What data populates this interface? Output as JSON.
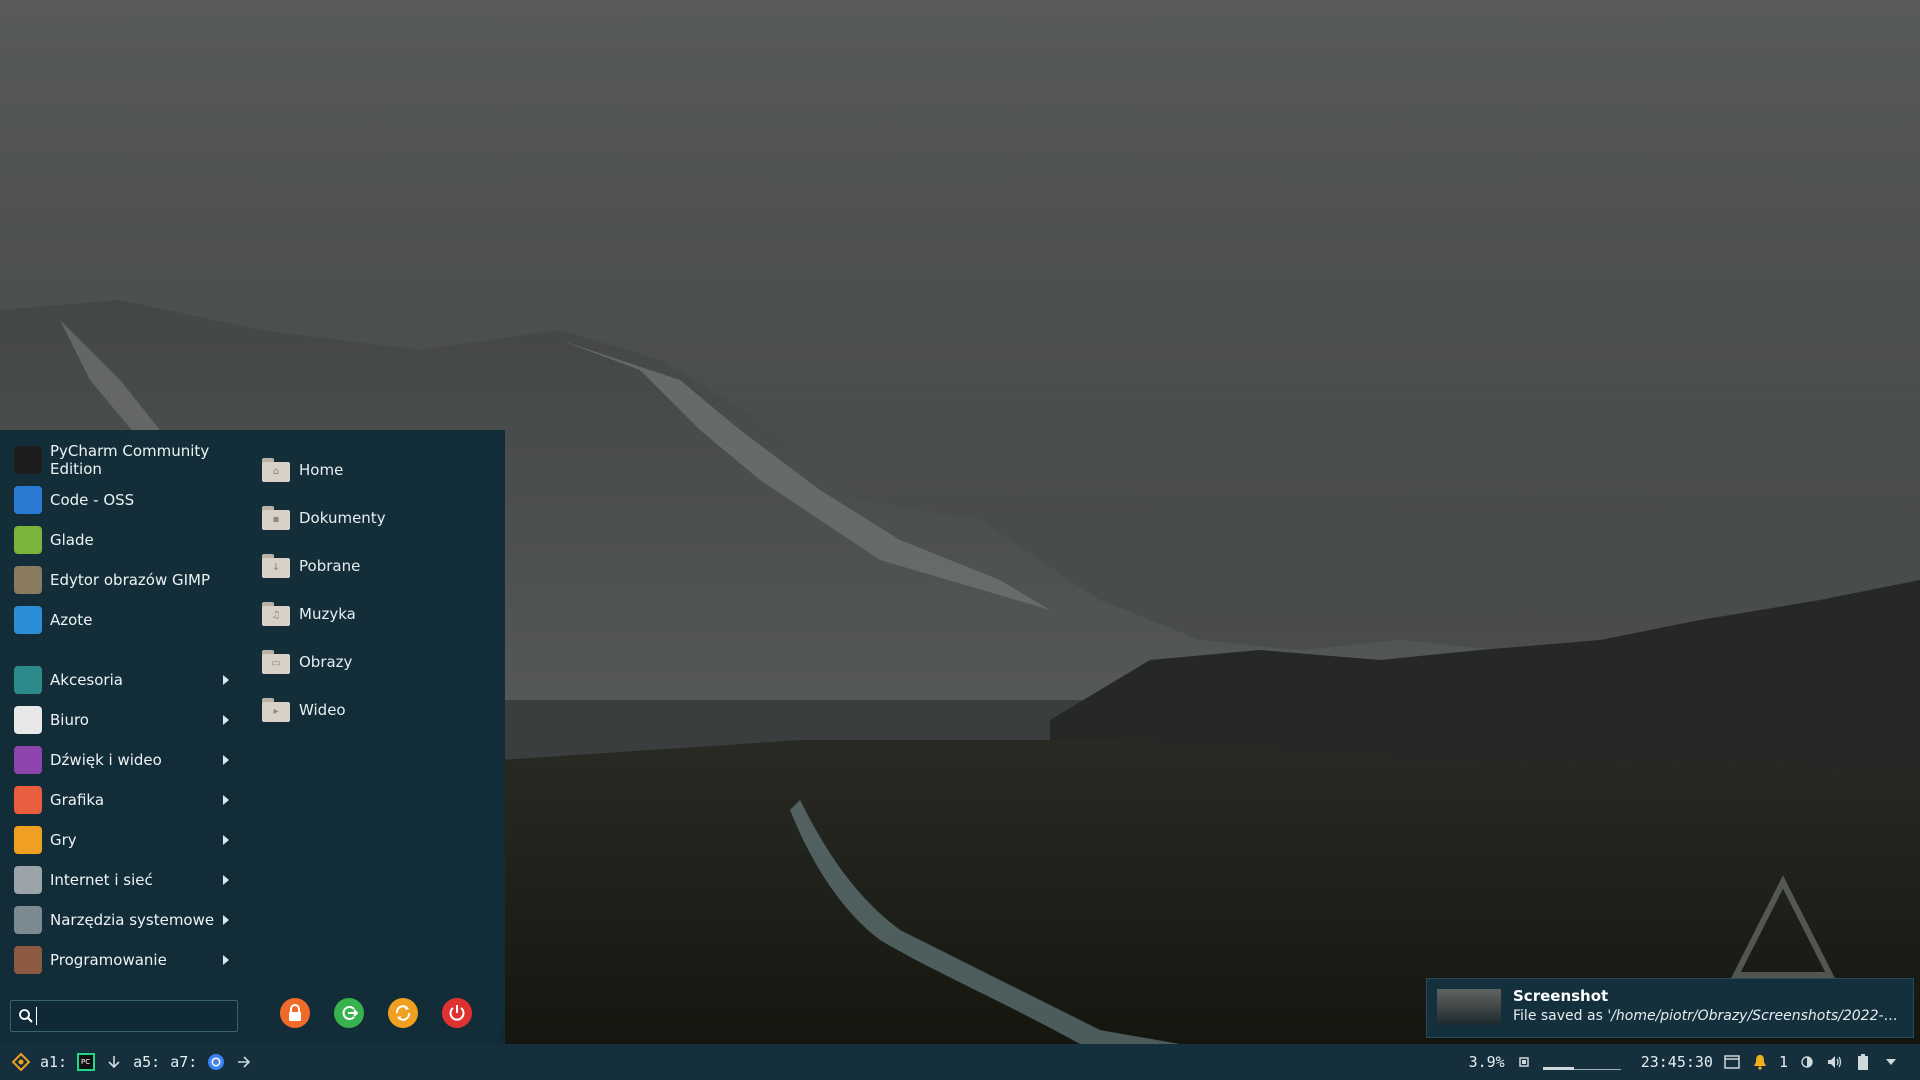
{
  "menu": {
    "favorites": [
      {
        "label": "PyCharm Community Edition",
        "icon": "pycharm-icon",
        "color": "#1d1d1d"
      },
      {
        "label": "Code - OSS",
        "icon": "code-oss-icon",
        "color": "#2a7ad3"
      },
      {
        "label": "Glade",
        "icon": "glade-icon",
        "color": "#7bb43a"
      },
      {
        "label": "Edytor obrazów GIMP",
        "icon": "gimp-icon",
        "color": "#8a7b60"
      },
      {
        "label": "Azote",
        "icon": "azote-icon",
        "color": "#2a8fd8"
      }
    ],
    "categories": [
      {
        "label": "Akcesoria",
        "icon": "accessories-icon",
        "color": "#2c8a8a"
      },
      {
        "label": "Biuro",
        "icon": "office-icon",
        "color": "#e8e8e8"
      },
      {
        "label": "Dźwięk i wideo",
        "icon": "multimedia-icon",
        "color": "#8e44ad"
      },
      {
        "label": "Grafika",
        "icon": "graphics-icon",
        "color": "#e85d3d"
      },
      {
        "label": "Gry",
        "icon": "games-icon",
        "color": "#f0a020"
      },
      {
        "label": "Internet i sieć",
        "icon": "network-icon",
        "color": "#9aa4a8"
      },
      {
        "label": "Narzędzia systemowe",
        "icon": "system-tools-icon",
        "color": "#7a8a90"
      },
      {
        "label": "Programowanie",
        "icon": "development-icon",
        "color": "#8b5a40"
      }
    ],
    "places": [
      {
        "label": "Home",
        "glyph": "⌂"
      },
      {
        "label": "Dokumenty",
        "glyph": "▪"
      },
      {
        "label": "Pobrane",
        "glyph": "↓"
      },
      {
        "label": "Muzyka",
        "glyph": "♫"
      },
      {
        "label": "Obrazy",
        "glyph": "▭"
      },
      {
        "label": "Wideo",
        "glyph": "▸"
      }
    ],
    "search": {
      "value": "",
      "placeholder": ""
    },
    "system_buttons": [
      {
        "name": "lock-button",
        "color": "#f06a2a"
      },
      {
        "name": "logout-button",
        "color": "#37b24d"
      },
      {
        "name": "restart-button",
        "color": "#f0a020"
      },
      {
        "name": "power-button",
        "color": "#e03131"
      }
    ]
  },
  "notification": {
    "title": "Screenshot",
    "body_prefix": "File saved as ",
    "body_path": "'/home/piotr/Obrazy/Screenshots/2022-0..."
  },
  "taskbar": {
    "ws1": "a1:",
    "ws5": "a5:",
    "ws7": "a7:",
    "cpu": "3.9%",
    "clock": "23:45:30",
    "notifications_count": "1",
    "memory_fraction": 0.4
  }
}
